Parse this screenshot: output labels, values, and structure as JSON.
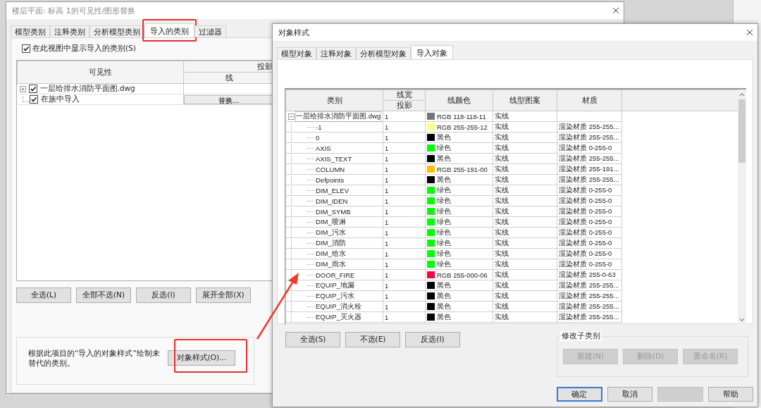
{
  "visibility_dialog": {
    "title": "楼层平面: 标高 1的可见性/图形替换",
    "tabs": [
      {
        "label": "模型类别",
        "selected": false,
        "highlighted": false
      },
      {
        "label": "注释类别",
        "selected": false,
        "highlighted": false
      },
      {
        "label": "分析模型类别",
        "selected": false,
        "highlighted": false
      },
      {
        "label": "导入的类别",
        "selected": true,
        "highlighted": true
      },
      {
        "label": "过滤器",
        "selected": false,
        "highlighted": false
      }
    ],
    "show_imported": {
      "label": "在此视图中显示导入的类别(S)",
      "checked": true
    },
    "table": {
      "columns": [
        "可见性",
        "投影",
        "线"
      ],
      "rows": [
        {
          "name": "一层给排水消防平面图.dwg",
          "checked": true,
          "expanded": false
        },
        {
          "name": "在族中导入",
          "checked": true,
          "override": "替换..."
        }
      ]
    },
    "buttons": [
      "全选(L)",
      "全部不选(N)",
      "反选(I)",
      "展开全部(X)"
    ],
    "note": {
      "text": "根据此项目的“导入的对象样式”绘制未替代的类别。",
      "button": "对象样式(O)...",
      "highlighted": true
    }
  },
  "object_styles_dialog": {
    "title": "对象样式",
    "tabs": [
      {
        "label": "模型对象",
        "selected": false
      },
      {
        "label": "注释对象",
        "selected": false
      },
      {
        "label": "分析模型对象",
        "selected": false
      },
      {
        "label": "导入对象",
        "selected": true
      }
    ],
    "table": {
      "columns": [
        {
          "label": "类别"
        },
        {
          "label": "线宽",
          "sub": "投影"
        },
        {
          "label": "线颜色"
        },
        {
          "label": "线型图案"
        },
        {
          "label": "材质"
        }
      ],
      "rows": [
        {
          "category": "一层给排水消防平面图.dwg",
          "weight": "1",
          "color": "#767676",
          "color_name": "RGB 118-118-11",
          "pattern": "实线",
          "expanded": true,
          "children": [
            {
              "category": "-1",
              "weight": "1",
              "color": "#ffff80",
              "color_name": "RGB 255-255-12",
              "pattern": "实线",
              "material": "渲染材质 255-255..."
            },
            {
              "category": "0",
              "weight": "1",
              "color": "#000000",
              "color_name": "黑色",
              "pattern": "实线",
              "material": "渲染材质 255-255..."
            },
            {
              "category": "AXIS",
              "weight": "1",
              "color": "#00ff00",
              "color_name": "绿色",
              "pattern": "实线",
              "material": "渲染材质 0-255-0"
            },
            {
              "category": "AXIS_TEXT",
              "weight": "1",
              "color": "#000000",
              "color_name": "黑色",
              "pattern": "实线",
              "material": "渲染材质 255-255..."
            },
            {
              "category": "COLUMN",
              "weight": "1",
              "color": "#ffbf00",
              "color_name": "RGB 255-191-00",
              "pattern": "实线",
              "material": "渲染材质 255-191..."
            },
            {
              "category": "Defpoints",
              "weight": "1",
              "color": "#000000",
              "color_name": "黑色",
              "pattern": "实线",
              "material": "渲染材质 255-255..."
            },
            {
              "category": "DIM_ELEV",
              "weight": "1",
              "color": "#00ff00",
              "color_name": "绿色",
              "pattern": "实线",
              "material": "渲染材质 0-255-0"
            },
            {
              "category": "DIM_IDEN",
              "weight": "1",
              "color": "#00ff00",
              "color_name": "绿色",
              "pattern": "实线",
              "material": "渲染材质 0-255-0"
            },
            {
              "category": "DIM_SYMB",
              "weight": "1",
              "color": "#00ff00",
              "color_name": "绿色",
              "pattern": "实线",
              "material": "渲染材质 0-255-0"
            },
            {
              "category": "DIM_喷淋",
              "weight": "1",
              "color": "#00ff00",
              "color_name": "绿色",
              "pattern": "实线",
              "material": "渲染材质 0-255-0"
            },
            {
              "category": "DIM_污水",
              "weight": "1",
              "color": "#00ff00",
              "color_name": "绿色",
              "pattern": "实线",
              "material": "渲染材质 0-255-0"
            },
            {
              "category": "DIM_消防",
              "weight": "1",
              "color": "#00ff00",
              "color_name": "绿色",
              "pattern": "实线",
              "material": "渲染材质 0-255-0"
            },
            {
              "category": "DIM_给水",
              "weight": "1",
              "color": "#00ff00",
              "color_name": "绿色",
              "pattern": "实线",
              "material": "渲染材质 0-255-0"
            },
            {
              "category": "DIM_雨水",
              "weight": "1",
              "color": "#00ff00",
              "color_name": "绿色",
              "pattern": "实线",
              "material": "渲染材质 0-255-0"
            },
            {
              "category": "DOOR_FIRE",
              "weight": "1",
              "color": "#ff003f",
              "color_name": "RGB 255-000-06",
              "pattern": "实线",
              "material": "渲染材质 255-0-63"
            },
            {
              "category": "EQUIP_地漏",
              "weight": "1",
              "color": "#000000",
              "color_name": "黑色",
              "pattern": "实线",
              "material": "渲染材质 255-255..."
            },
            {
              "category": "EQUIP_污水",
              "weight": "1",
              "color": "#000000",
              "color_name": "黑色",
              "pattern": "实线",
              "material": "渲染材质 255-255..."
            },
            {
              "category": "EQUIP_消火栓",
              "weight": "1",
              "color": "#000000",
              "color_name": "黑色",
              "pattern": "实线",
              "material": "渲染材质 255-255..."
            },
            {
              "category": "EQUIP_灭火器",
              "weight": "1",
              "color": "#000000",
              "color_name": "黑色",
              "pattern": "实线",
              "material": "渲染材质 255-255..."
            }
          ]
        }
      ]
    },
    "buttons": [
      "全选(S)",
      "不选(E)",
      "反选(I)"
    ],
    "subcategory": {
      "title": "修改子类别",
      "buttons": [
        {
          "label": "新建(N)",
          "disabled": true
        },
        {
          "label": "删除(D)",
          "disabled": true
        },
        {
          "label": "重命名(R)",
          "disabled": true
        }
      ]
    },
    "footer": [
      {
        "label": "确定",
        "default": true,
        "disabled": false
      },
      {
        "label": "取消",
        "default": false,
        "disabled": false
      },
      {
        "default": false,
        "disabled": true
      },
      {
        "label": "帮助",
        "default": false,
        "disabled": false
      }
    ]
  }
}
